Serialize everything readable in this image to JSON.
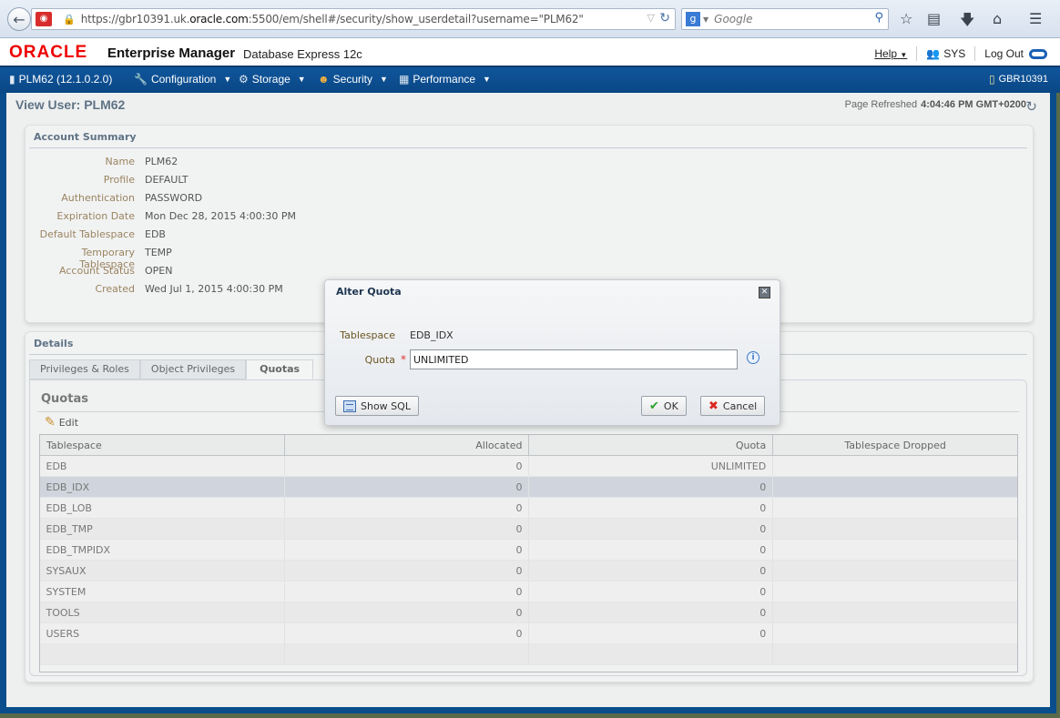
{
  "browser": {
    "url_prefix": "https://gbr10391.uk.",
    "url_domain": "oracle.com",
    "url_suffix": ":5500/em/shell#/security/show_userdetail?username=\"PLM62\"",
    "search_placeholder": "Google",
    "icons": [
      "back-icon",
      "site-icon",
      "lock-icon",
      "reload-icon",
      "google-icon",
      "search-icon",
      "bookmark-star-icon",
      "reading-list-icon",
      "download-icon",
      "home-icon",
      "menu-icon"
    ]
  },
  "header": {
    "logo": "ORACLE",
    "product": "Enterprise Manager",
    "subtitle": "Database Express 12c",
    "help": "Help",
    "user": "SYS",
    "logout": "Log Out"
  },
  "nav": {
    "database": "PLM62 (12.1.0.2.0)",
    "menus": [
      {
        "label": "Configuration",
        "icon": "wrench-icon"
      },
      {
        "label": "Storage",
        "icon": "storage-icon"
      },
      {
        "label": "Security",
        "icon": "security-icon"
      },
      {
        "label": "Performance",
        "icon": "performance-icon"
      }
    ],
    "host": "GBR10391"
  },
  "page": {
    "title": "View User: PLM62",
    "refreshed_label": "Page Refreshed",
    "refreshed_time": "4:04:46 PM GMT+0200"
  },
  "account_summary": {
    "title": "Account Summary",
    "fields": [
      {
        "label": "Name",
        "value": "PLM62"
      },
      {
        "label": "Profile",
        "value": "DEFAULT"
      },
      {
        "label": "Authentication",
        "value": "PASSWORD"
      },
      {
        "label": "Expiration Date",
        "value": "Mon Dec 28, 2015 4:00:30 PM"
      },
      {
        "label": "Default Tablespace",
        "value": "EDB"
      },
      {
        "label": "Temporary Tablespace",
        "value": "TEMP"
      },
      {
        "label": "Account Status",
        "value": "OPEN"
      },
      {
        "label": "Created",
        "value": "Wed Jul 1, 2015 4:00:30 PM"
      }
    ]
  },
  "details": {
    "title": "Details",
    "tabs": [
      {
        "label": "Privileges & Roles",
        "active": false
      },
      {
        "label": "Object Privileges",
        "active": false
      },
      {
        "label": "Quotas",
        "active": true
      }
    ],
    "quotas_title": "Quotas",
    "edit_label": "Edit",
    "columns": [
      "Tablespace",
      "Allocated",
      "Quota",
      "Tablespace Dropped"
    ],
    "rows": [
      {
        "tablespace": "EDB",
        "allocated": "0",
        "quota": "UNLIMITED",
        "dropped": "",
        "selected": false
      },
      {
        "tablespace": "EDB_IDX",
        "allocated": "0",
        "quota": "0",
        "dropped": "",
        "selected": true
      },
      {
        "tablespace": "EDB_LOB",
        "allocated": "0",
        "quota": "0",
        "dropped": "",
        "selected": false
      },
      {
        "tablespace": "EDB_TMP",
        "allocated": "0",
        "quota": "0",
        "dropped": "",
        "selected": false
      },
      {
        "tablespace": "EDB_TMPIDX",
        "allocated": "0",
        "quota": "0",
        "dropped": "",
        "selected": false
      },
      {
        "tablespace": "SYSAUX",
        "allocated": "0",
        "quota": "0",
        "dropped": "",
        "selected": false
      },
      {
        "tablespace": "SYSTEM",
        "allocated": "0",
        "quota": "0",
        "dropped": "",
        "selected": false
      },
      {
        "tablespace": "TOOLS",
        "allocated": "0",
        "quota": "0",
        "dropped": "",
        "selected": false
      },
      {
        "tablespace": "USERS",
        "allocated": "0",
        "quota": "0",
        "dropped": "",
        "selected": false
      }
    ]
  },
  "dialog": {
    "title": "Alter Quota",
    "tablespace_label": "Tablespace",
    "tablespace_value": "EDB_IDX",
    "quota_label": "Quota",
    "required_mark": "*",
    "quota_value": "UNLIMITED",
    "show_sql": "Show SQL",
    "ok": "OK",
    "cancel": "Cancel"
  }
}
